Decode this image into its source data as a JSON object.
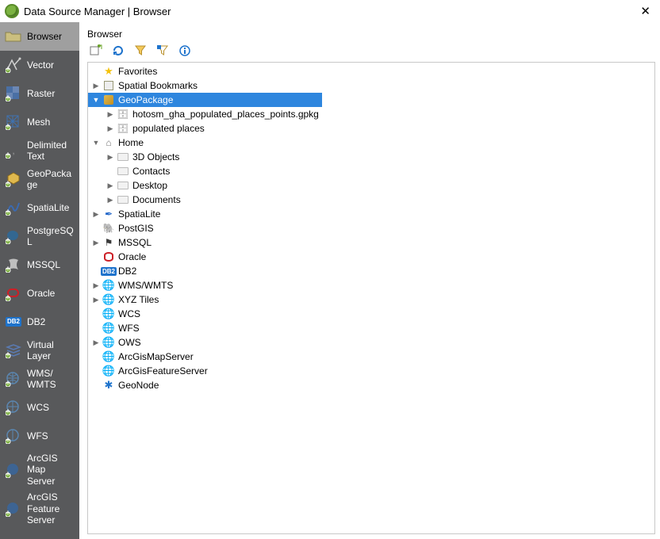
{
  "window": {
    "title": "Data Source Manager | Browser"
  },
  "sidebar": {
    "items": [
      {
        "label": "Browser"
      },
      {
        "label": "Vector"
      },
      {
        "label": "Raster"
      },
      {
        "label": "Mesh"
      },
      {
        "label": "Delimited Text"
      },
      {
        "label": "GeoPackage"
      },
      {
        "label": "SpatiaLite"
      },
      {
        "label": "PostgreSQL"
      },
      {
        "label": "MSSQL"
      },
      {
        "label": "Oracle"
      },
      {
        "label": "DB2"
      },
      {
        "label": "Virtual Layer"
      },
      {
        "label": "WMS/ WMTS"
      },
      {
        "label": "WCS"
      },
      {
        "label": "WFS"
      },
      {
        "label": "ArcGIS Map Server"
      },
      {
        "label": "ArcGIS Feature Server"
      }
    ]
  },
  "panel": {
    "title": "Browser"
  },
  "toolbar": {
    "add": "＋",
    "refresh": "⟳",
    "filter": "⧩",
    "collapse": "🗂",
    "info": "ⓘ"
  },
  "tree": {
    "favorites": "Favorites",
    "spatial_bookmarks": "Spatial Bookmarks",
    "geopackage": "GeoPackage",
    "gpkg_children": [
      "hotosm_gha_populated_places_points.gpkg",
      "populated places"
    ],
    "home": "Home",
    "home_children": [
      "3D Objects",
      "Contacts",
      "Desktop",
      "Documents"
    ],
    "spatialite": "SpatiaLite",
    "postgis": "PostGIS",
    "mssql": "MSSQL",
    "oracle": "Oracle",
    "db2": "DB2",
    "wms": "WMS/WMTS",
    "xyz": "XYZ Tiles",
    "wcs": "WCS",
    "wfs": "WFS",
    "ows": "OWS",
    "arcgis_map": "ArcGisMapServer",
    "arcgis_feat": "ArcGisFeatureServer",
    "geonode": "GeoNode"
  }
}
